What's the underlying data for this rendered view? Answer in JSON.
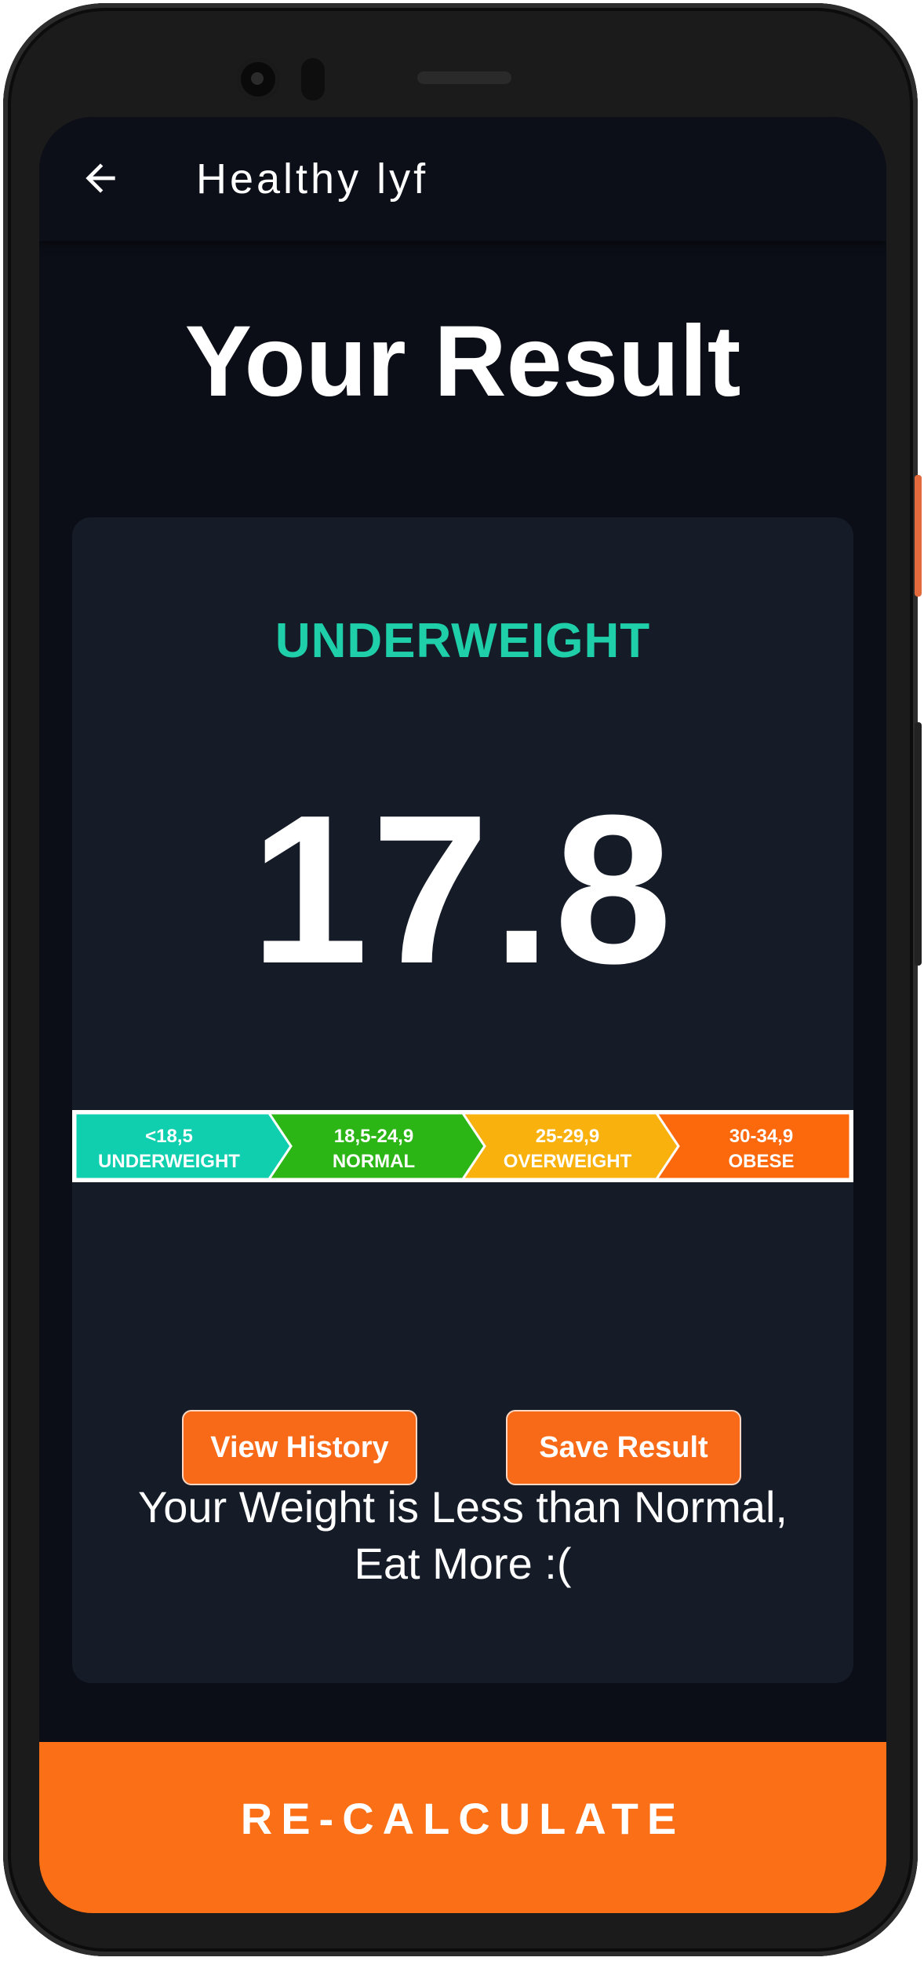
{
  "app": {
    "title": "Healthy lyf"
  },
  "page": {
    "title": "Your Result"
  },
  "result": {
    "category": "UNDERWEIGHT",
    "bmi": "17.8",
    "message_line1": "Your Weight is Less than Normal,",
    "message_line2": "Eat More :("
  },
  "scale": {
    "segments": [
      {
        "range": "<18,5",
        "label": "UNDERWEIGHT",
        "color": "#0fcfaf"
      },
      {
        "range": "18,5-24,9",
        "label": "NORMAL",
        "color": "#2cb616"
      },
      {
        "range": "25-29,9",
        "label": "OVERWEIGHT",
        "color": "#f9b10d"
      },
      {
        "range": "30-34,9",
        "label": "OBESE",
        "color": "#fc680c"
      }
    ]
  },
  "buttons": {
    "view_history": "View History",
    "save_result": "Save Result",
    "recalculate": "RE-CALCULATE"
  },
  "colors": {
    "background": "#0b0e16",
    "card": "#151c28",
    "accent": "#fb6f16",
    "category": "#1ecfa9"
  }
}
